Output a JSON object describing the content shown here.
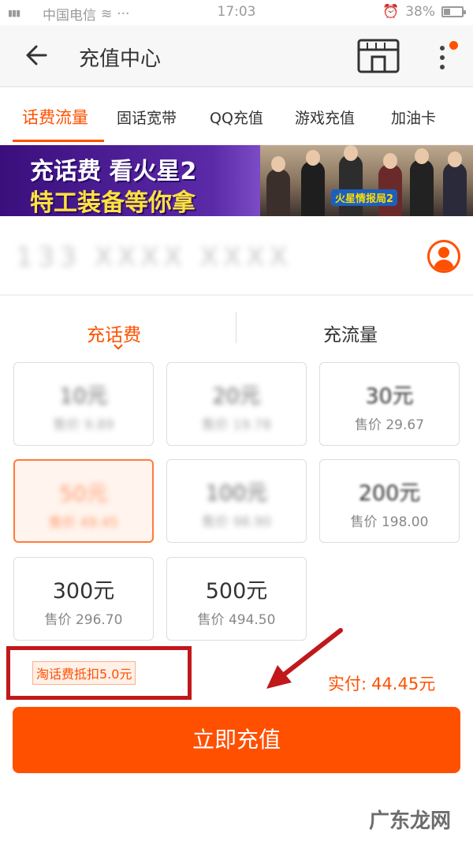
{
  "status_bar": {
    "carrier": "中国电信",
    "time": "17:03",
    "battery": "38%",
    "battery_level": 0.38
  },
  "header": {
    "title": "充值中心",
    "back_icon": "back-arrow-icon",
    "store_icon": "store-icon",
    "more_icon": "more-vertical-icon"
  },
  "tabs": [
    "话费流量",
    "固话宽带",
    "QQ充值",
    "游戏充值",
    "加油卡"
  ],
  "banner": {
    "line1": "充话费 看火星2",
    "line2": "特工装备等你拿",
    "logo": "火星情报局2"
  },
  "phone": {
    "number": "133 XXXX XXXX",
    "contact_icon": "contact-icon"
  },
  "subtabs": [
    "充话费",
    "充流量"
  ],
  "cards": [
    {
      "amount": "10元",
      "price": "售价 9.89"
    },
    {
      "amount": "20元",
      "price": "售价 19.78"
    },
    {
      "amount": "30元",
      "price": "售价 29.67"
    },
    {
      "amount": "50元",
      "price": "售价 49.45"
    },
    {
      "amount": "100元",
      "price": "售价 98.90"
    },
    {
      "amount": "200元",
      "price": "售价 198.00"
    },
    {
      "amount": "300元",
      "price": "售价 296.70"
    },
    {
      "amount": "500元",
      "price": "售价 494.50"
    }
  ],
  "discount": "淘话费抵扣5.0元",
  "pay": {
    "label": "实付:",
    "amount": "44.45元"
  },
  "recharge_button": "立即充值",
  "watermark": "广东龙网",
  "colors": {
    "accent": "#ff5000",
    "annotation": "#c0181b"
  }
}
